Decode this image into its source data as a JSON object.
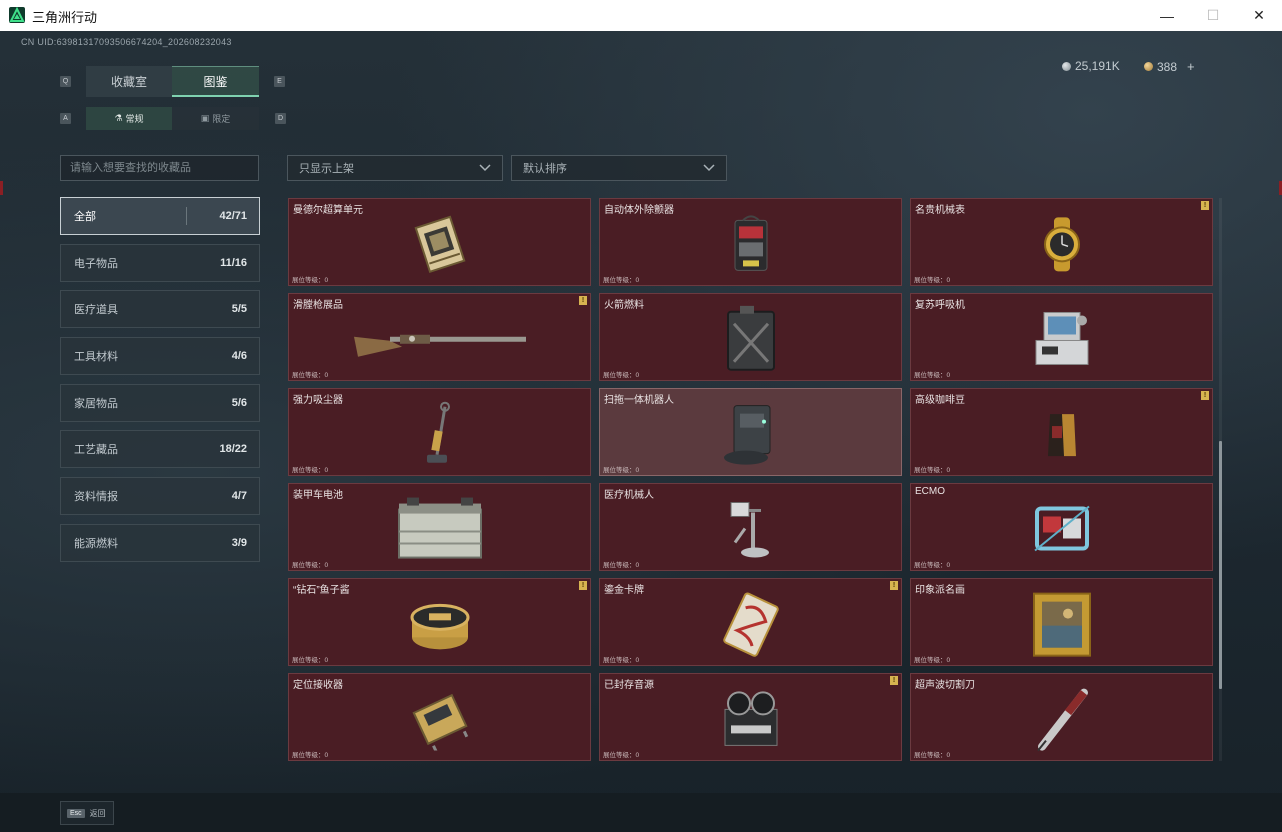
{
  "window": {
    "title": "三角洲行动",
    "minimize_glyph": "—",
    "maximize_glyph": "☐",
    "close_glyph": "✕"
  },
  "header": {
    "uid_text": "CN UID:639813170935066742​04_202608232043",
    "silver_amount": "25,191K",
    "gold_amount": "388",
    "add_glyph": "+"
  },
  "tabs": {
    "main": [
      {
        "label": "收藏室",
        "active": false
      },
      {
        "label": "图鉴",
        "active": true
      }
    ],
    "main_key_left": "Q",
    "main_key_right": "E",
    "sub": [
      {
        "label": "常规",
        "active": true,
        "icon": "flask-icon"
      },
      {
        "label": "限定",
        "active": false,
        "icon": "badge-icon"
      }
    ],
    "sub_key_left": "A",
    "sub_key_right": "D"
  },
  "search": {
    "placeholder": "请输入想要查找的收藏品"
  },
  "filters": {
    "show_filter": "只显示上架",
    "sort": "默认排序"
  },
  "categories": [
    {
      "label": "全部",
      "count": "42/71",
      "active": true
    },
    {
      "label": "电子物品",
      "count": "11/16",
      "active": false
    },
    {
      "label": "医疗道具",
      "count": "5/5",
      "active": false
    },
    {
      "label": "工具材料",
      "count": "4/6",
      "active": false
    },
    {
      "label": "家居物品",
      "count": "5/6",
      "active": false
    },
    {
      "label": "工艺藏品",
      "count": "18/22",
      "active": false
    },
    {
      "label": "资料情报",
      "count": "4/7",
      "active": false
    },
    {
      "label": "能源燃料",
      "count": "3/9",
      "active": false
    }
  ],
  "items": [
    {
      "name": "曼德尔超算单元",
      "level": "展位等级：0",
      "flag": false,
      "icon": "cpu-icon"
    },
    {
      "name": "自动体外除颤器",
      "level": "展位等级：0",
      "flag": false,
      "icon": "defibrillator-icon"
    },
    {
      "name": "名贵机械表",
      "level": "展位等级：0",
      "flag": true,
      "icon": "watch-icon"
    },
    {
      "name": "滑膛枪展品",
      "level": "展位等级：0",
      "flag": true,
      "icon": "musket-icon"
    },
    {
      "name": "火箭燃料",
      "level": "展位等级：0",
      "flag": false,
      "icon": "fuel-can-icon"
    },
    {
      "name": "复苏呼吸机",
      "level": "展位等级：0",
      "flag": false,
      "icon": "ventilator-icon"
    },
    {
      "name": "强力吸尘器",
      "level": "展位等级：0",
      "flag": false,
      "icon": "vacuum-icon"
    },
    {
      "name": "扫拖一体机器人",
      "level": "展位等级：0",
      "flag": false,
      "icon": "robot-vacuum-icon"
    },
    {
      "name": "高级咖啡豆",
      "level": "展位等级：0",
      "flag": true,
      "icon": "coffee-bag-icon"
    },
    {
      "name": "装甲车电池",
      "level": "展位等级：0",
      "flag": false,
      "icon": "battery-icon"
    },
    {
      "name": "医疗机械人",
      "level": "展位等级：0",
      "flag": false,
      "icon": "medical-robot-icon"
    },
    {
      "name": "ECMO",
      "level": "展位等级：0",
      "flag": false,
      "icon": "ecmo-icon"
    },
    {
      "name": "“钻石”鱼子酱",
      "level": "展位等级：0",
      "flag": true,
      "icon": "caviar-tin-icon"
    },
    {
      "name": "鎏金卡牌",
      "level": "展位等级：0",
      "flag": true,
      "icon": "gilded-card-icon"
    },
    {
      "name": "印象派名画",
      "level": "展位等级：0",
      "flag": false,
      "icon": "painting-icon"
    },
    {
      "name": "定位接收器",
      "level": "展位等级：0",
      "flag": false,
      "icon": "receiver-icon"
    },
    {
      "name": "已封存音源",
      "level": "展位等级：0",
      "flag": true,
      "icon": "tape-recorder-icon"
    },
    {
      "name": "超声波切割刀",
      "level": "展位等级：0",
      "flag": false,
      "icon": "ultrasonic-knife-icon"
    }
  ],
  "flag_glyph": "!",
  "footer": {
    "esc_key": "Esc",
    "esc_label": "返回"
  },
  "colors": {
    "card_bg": "#4a1d24",
    "card_highlight_bg": "#5b3a3e",
    "accent_green": "#7fd2b0",
    "flag_yellow": "#d7b450"
  }
}
